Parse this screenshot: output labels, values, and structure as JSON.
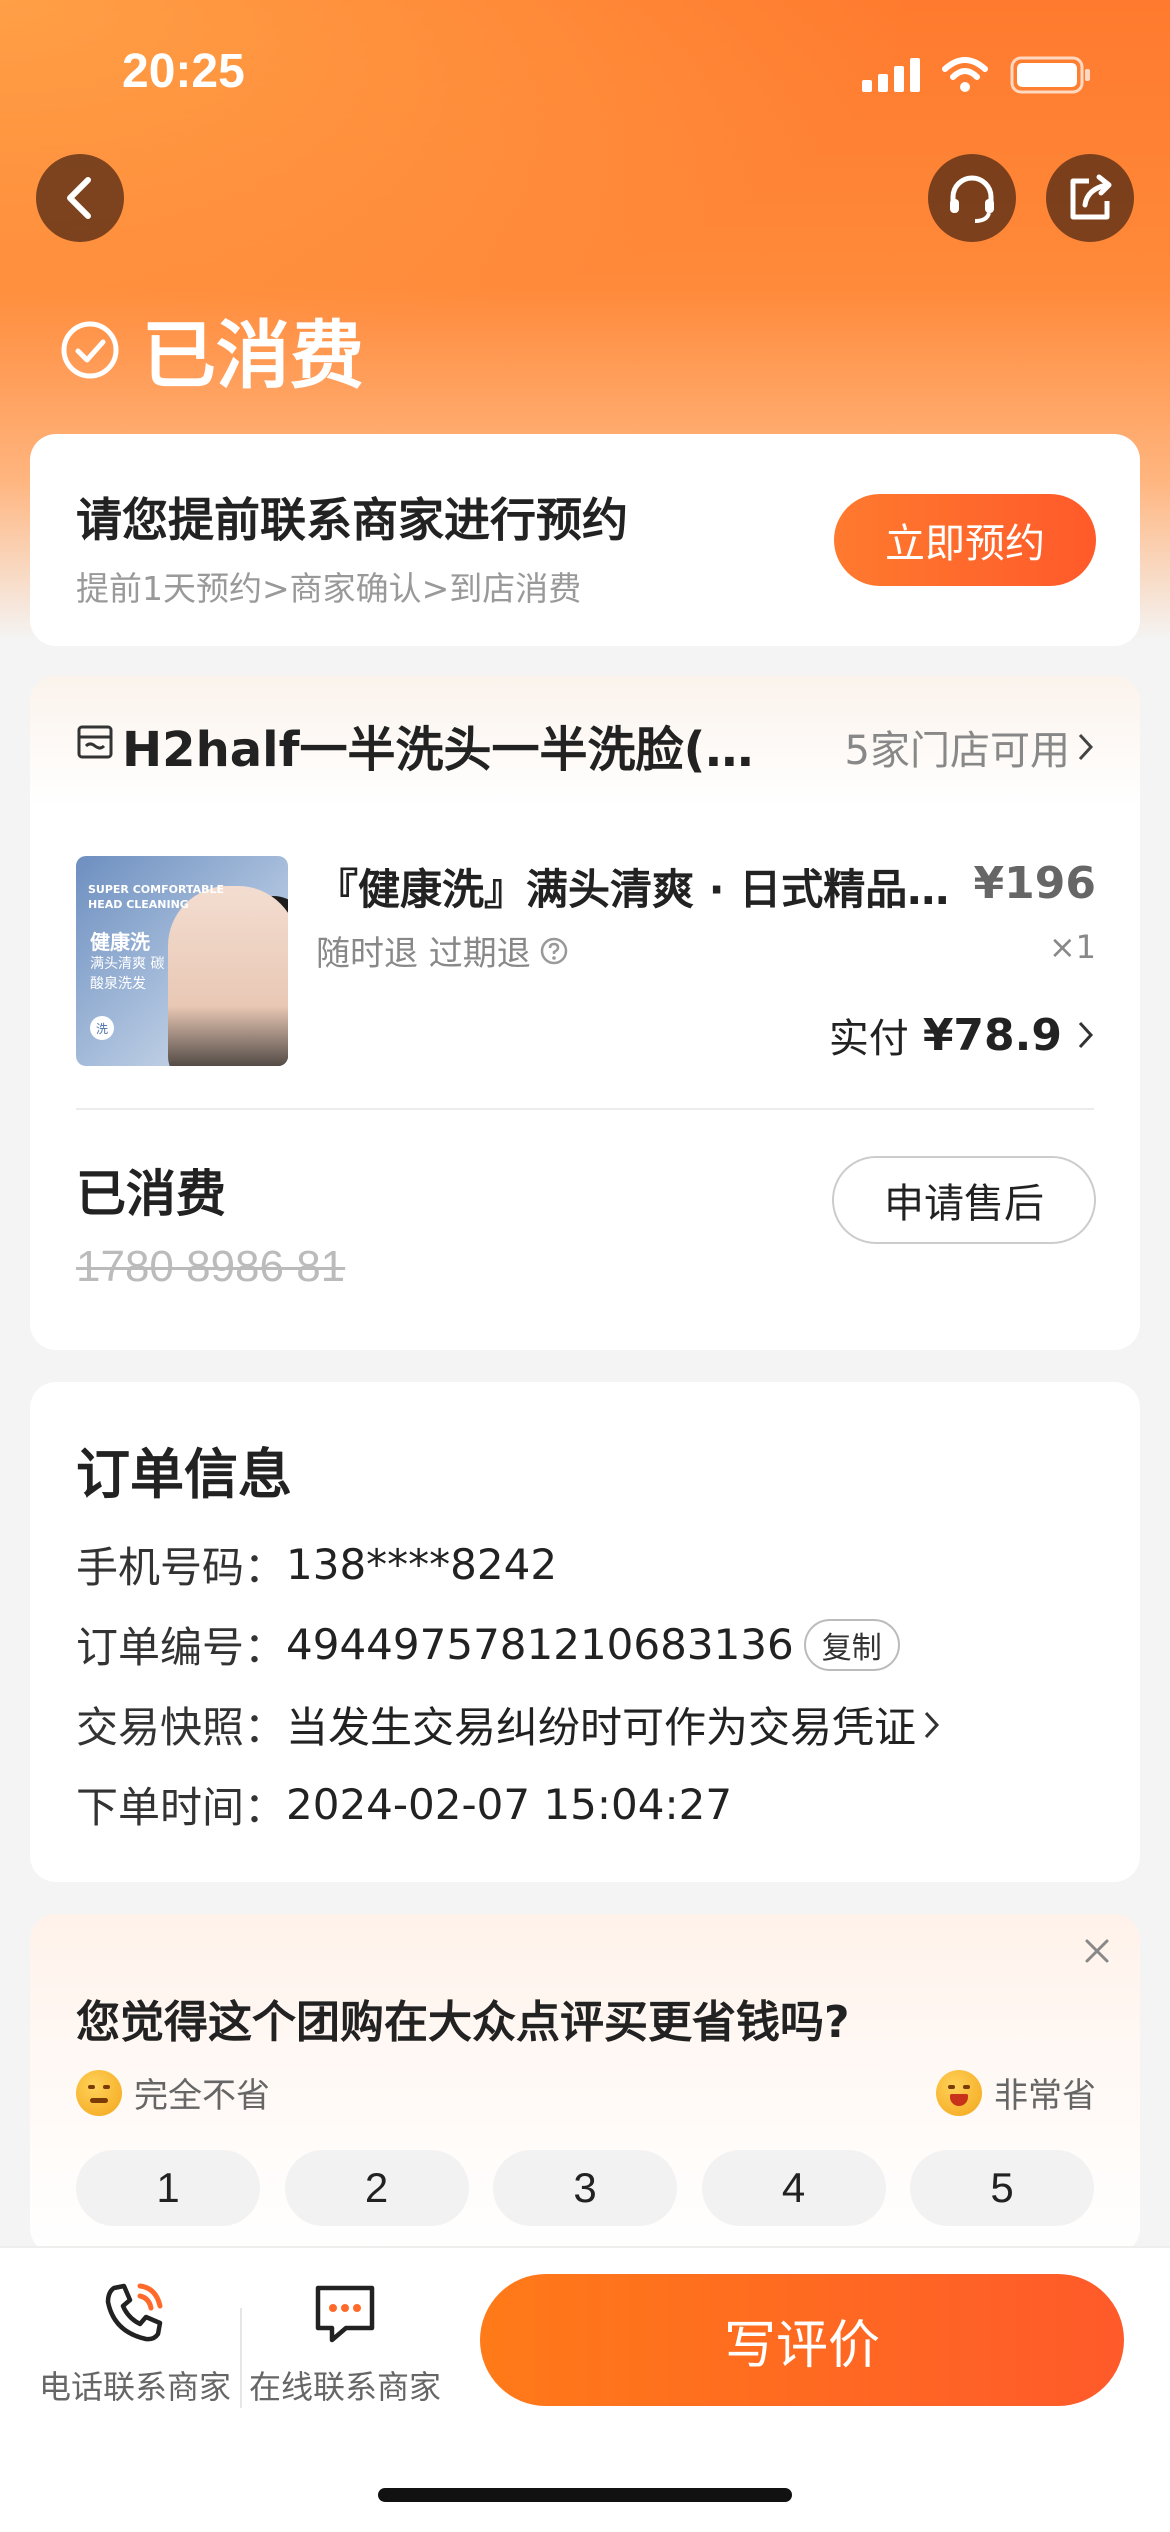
{
  "status_bar": {
    "time": "20:25"
  },
  "header": {
    "status_title": "已消费"
  },
  "reservation": {
    "main_text": "请您提前联系商家进行预约",
    "sub_text": "提前1天预约>商家确认>到店消费",
    "button_label": "立即预约"
  },
  "deal": {
    "shop_name": "H2half一半洗头一半洗脸(…",
    "stores_available": "5家门店可用",
    "thumbnail": {
      "line1": "SUPER COMFORTABLE HEAD CLEANING",
      "line2": "健康洗",
      "line3": "满头清爽 碳酸泉洗发",
      "badge": "洗"
    },
    "product_title": "『健康洗』满头清爽 · 日式精品碳酸泉洗发",
    "price": "¥196",
    "tags": "随时退 过期退",
    "quantity": "×1",
    "paid_label": "实付",
    "paid_amount": "¥78.9",
    "consumed_status": "已消费",
    "voucher_code": "1780 8986 81",
    "after_sale_button": "申请售后"
  },
  "order_info": {
    "title": "订单信息",
    "rows": [
      {
        "label": "手机号码：",
        "value": "138****8242"
      },
      {
        "label": "订单编号：",
        "value": "4944975781210683136",
        "chip": "复制"
      },
      {
        "label": "交易快照：",
        "value": "当发生交易纠纷时可作为交易凭证"
      },
      {
        "label": "下单时间：",
        "value": "2024-02-07 15:04:27"
      }
    ]
  },
  "survey": {
    "question": "您觉得这个团购在大众点评买更省钱吗?",
    "left_label": "完全不省",
    "right_label": "非常省",
    "scale": [
      "1",
      "2",
      "3",
      "4",
      "5"
    ]
  },
  "bottom_bar": {
    "call_label": "电话联系商家",
    "chat_label": "在线联系商家",
    "review_button": "写评价"
  },
  "colors": {
    "accent": "#ff6a2a",
    "hero_top": "#ff7a2e"
  }
}
